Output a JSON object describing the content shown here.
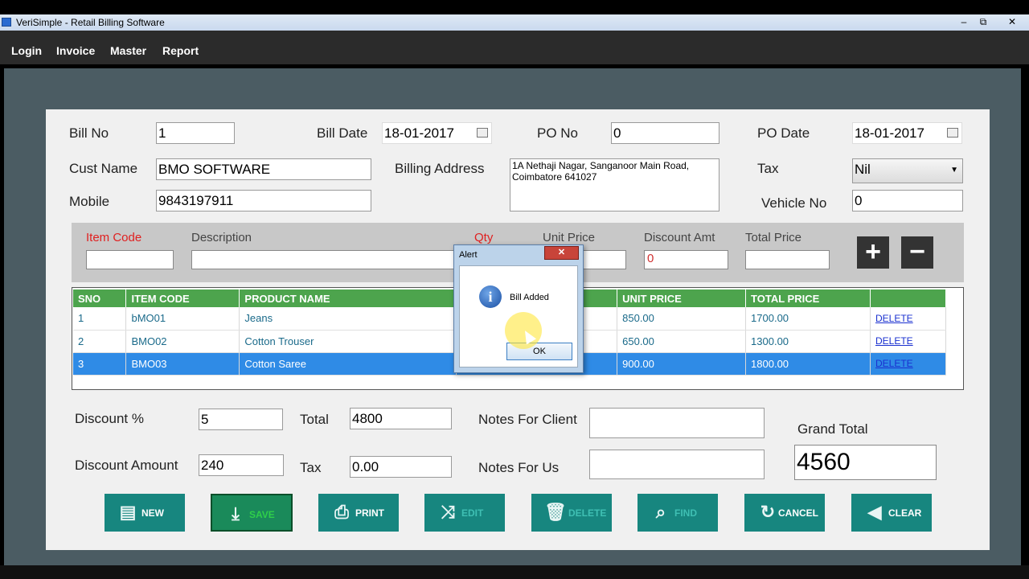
{
  "window": {
    "title": "VeriSimple - Retail Billing Software",
    "minimize": "‒",
    "maximize": "⧉",
    "close": "✕"
  },
  "menu": [
    "Login",
    "Invoice",
    "Master",
    "Report"
  ],
  "header": {
    "bill_no_label": "Bill No",
    "bill_no": "1",
    "bill_date_label": "Bill Date",
    "bill_date": "18-01-2017",
    "po_no_label": "PO No",
    "po_no": "0",
    "po_date_label": "PO Date",
    "po_date": "18-01-2017",
    "cust_name_label": "Cust Name",
    "cust_name": "BMO SOFTWARE",
    "billing_address_label": "Billing Address",
    "billing_address": "1A Nethaji Nagar, Sanganoor Main Road, Coimbatore 641027",
    "tax_label": "Tax",
    "tax": "Nil",
    "mobile_label": "Mobile",
    "mobile": "9843197911",
    "vehicle_no_label": "Vehicle No",
    "vehicle_no": "0"
  },
  "item_entry": {
    "item_code_label": "Item Code",
    "description_label": "Description",
    "qty_label": "Qty",
    "unit_price_label": "Unit Price",
    "discount_amt_label": "Discount Amt",
    "total_price_label": "Total Price",
    "discount_amt": "0",
    "add": "+",
    "remove": "−"
  },
  "grid": {
    "columns": [
      "SNO",
      "ITEM CODE",
      "PRODUCT NAME",
      "",
      "UNIT PRICE",
      "TOTAL PRICE",
      ""
    ],
    "rows": [
      {
        "sno": "1",
        "code": "bMO01",
        "name": "Jeans",
        "qty": "",
        "unit": "850.00",
        "total": "1700.00",
        "action": "DELETE"
      },
      {
        "sno": "2",
        "code": "BMO02",
        "name": "Cotton Trouser",
        "qty": "",
        "unit": "650.00",
        "total": "1300.00",
        "action": "DELETE"
      },
      {
        "sno": "3",
        "code": "BMO03",
        "name": "Cotton Saree",
        "qty": "",
        "unit": "900.00",
        "total": "1800.00",
        "action": "DELETE"
      }
    ]
  },
  "summary": {
    "discount_pct_label": "Discount %",
    "discount_pct": "5",
    "total_label": "Total",
    "total": "4800",
    "notes_client_label": "Notes For Client",
    "notes_client": "",
    "discount_amount_label": "Discount Amount",
    "discount_amount": "240",
    "tax_label": "Tax",
    "tax": "0.00",
    "notes_us_label": "Notes For Us",
    "notes_us": "",
    "grand_total_label": "Grand Total",
    "grand_total": "4560"
  },
  "actions": [
    {
      "label": "NEW",
      "icon": "document-icon"
    },
    {
      "label": "SAVE",
      "icon": "download-icon"
    },
    {
      "label": "PRINT",
      "icon": "printer-icon"
    },
    {
      "label": "EDIT",
      "icon": "shuffle-icon"
    },
    {
      "label": "DELETE",
      "icon": "trash-icon"
    },
    {
      "label": "FIND",
      "icon": "search-icon"
    },
    {
      "label": "CANCEL",
      "icon": "refresh-icon"
    },
    {
      "label": "CLEAR",
      "icon": "back-arrow-icon"
    }
  ],
  "dialog": {
    "title": "Alert",
    "close": "✕",
    "message": "Bill Added",
    "ok": "OK",
    "icon": "i"
  },
  "colors": {
    "accent": "#17867f",
    "grid_header": "#4da44d",
    "selected_row": "#2f8be6",
    "required_label": "#e02020"
  }
}
